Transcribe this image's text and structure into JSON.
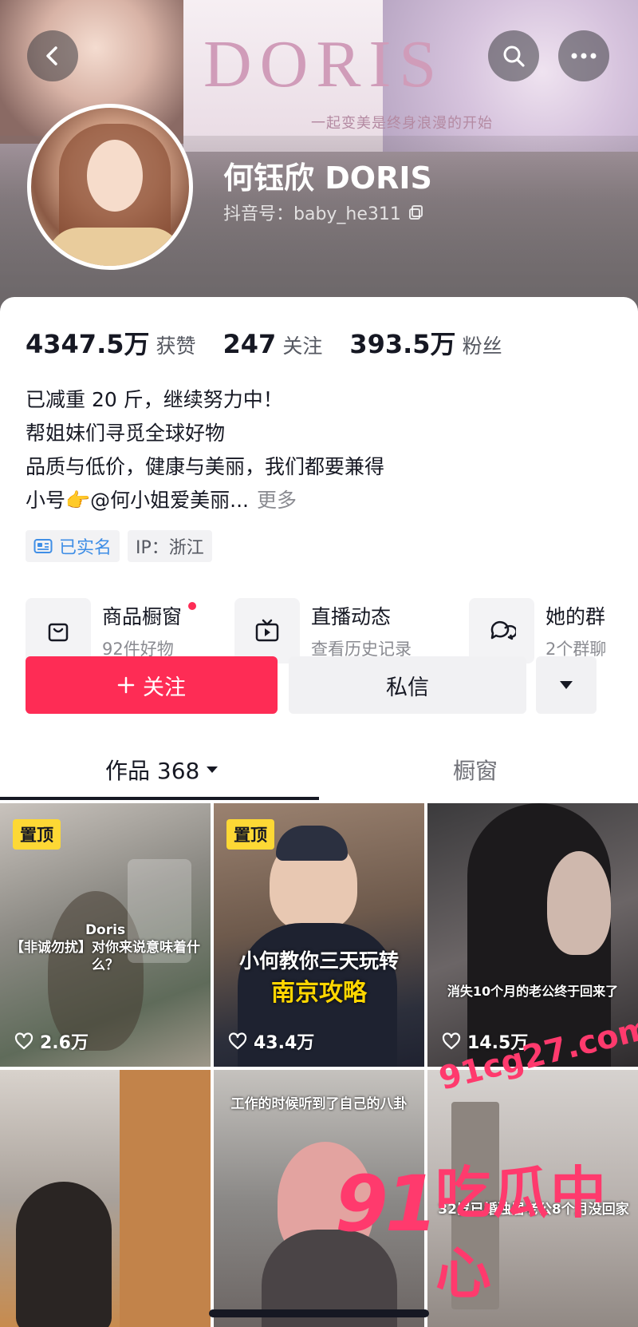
{
  "header": {
    "brand_logo": "DORIS",
    "brand_slogan": "一起变美是终身浪漫的开始",
    "nickname": "何钰欣 DORIS",
    "douyin_id": "抖音号：baby_he311"
  },
  "stats": [
    {
      "value": "4347.5万",
      "label": "获赞"
    },
    {
      "value": "247",
      "label": "关注"
    },
    {
      "value": "393.5万",
      "label": "粉丝"
    }
  ],
  "bio": {
    "lines": [
      "已减重 20 斤，继续努力中！",
      "帮姐妹们寻觅全球好物",
      "品质与低价，健康与美丽，我们都要兼得",
      "小号👉@何小姐爱美丽..."
    ],
    "more": "更多"
  },
  "tags": {
    "verified": "已实名",
    "ip": "IP：浙江"
  },
  "features": [
    {
      "title": "商品橱窗",
      "sub": "92件好物",
      "icon": "shopping-bag-icon"
    },
    {
      "title": "直播动态",
      "sub": "查看历史记录",
      "icon": "live-tv-icon"
    },
    {
      "title": "她的群",
      "sub": "2个群聊",
      "icon": "group-chat-icon"
    }
  ],
  "actions": {
    "follow": "关注",
    "message": "私信"
  },
  "tabs": {
    "works": "作品 368",
    "shop": "橱窗"
  },
  "videos": [
    {
      "pinned": "置顶",
      "caption": "Doris\n【非诚勿扰】对你来说意味着什么？",
      "likes": "2.6万"
    },
    {
      "pinned": "置顶",
      "caption_a": "小何教你三天玩转",
      "caption_b": "南京攻略",
      "likes": "43.4万"
    },
    {
      "caption": "消失10个月的老公终于回来了",
      "likes": "14.5万"
    },
    {
      "caption": ""
    },
    {
      "caption": "工作的时候听到了自己的八卦"
    },
    {
      "caption": "32岁已婚独居老公8个月没回家"
    }
  ],
  "watermark": {
    "url": "91cg27.com",
    "big": "91",
    "cn": "吃瓜中心"
  },
  "colors": {
    "accent": "#fe2c55",
    "pin": "#fdd835",
    "verified": "#3f8ee6"
  }
}
